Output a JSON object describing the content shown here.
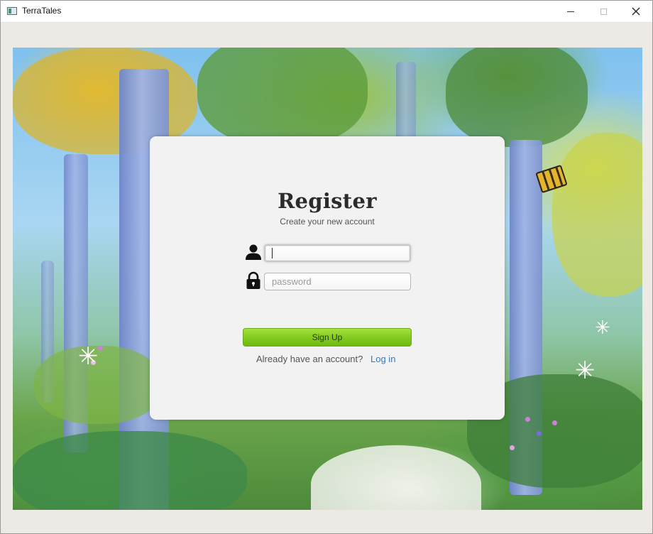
{
  "window": {
    "title": "TerraTales",
    "controls": {
      "minimize": "minimize",
      "maximize": "maximize",
      "close": "close"
    }
  },
  "form": {
    "heading": "Register",
    "subheading": "Create your new account",
    "username": {
      "value": "",
      "placeholder": "",
      "icon": "user-icon"
    },
    "password": {
      "value": "",
      "placeholder": "password",
      "icon": "lock-icon"
    },
    "signup_label": "Sign Up",
    "footer_text": "Already have an account?",
    "login_link": "Log in"
  },
  "colors": {
    "accent_green": "#84cc1f",
    "link_blue": "#2a7bd0",
    "card_bg": "#f2f2f2"
  }
}
